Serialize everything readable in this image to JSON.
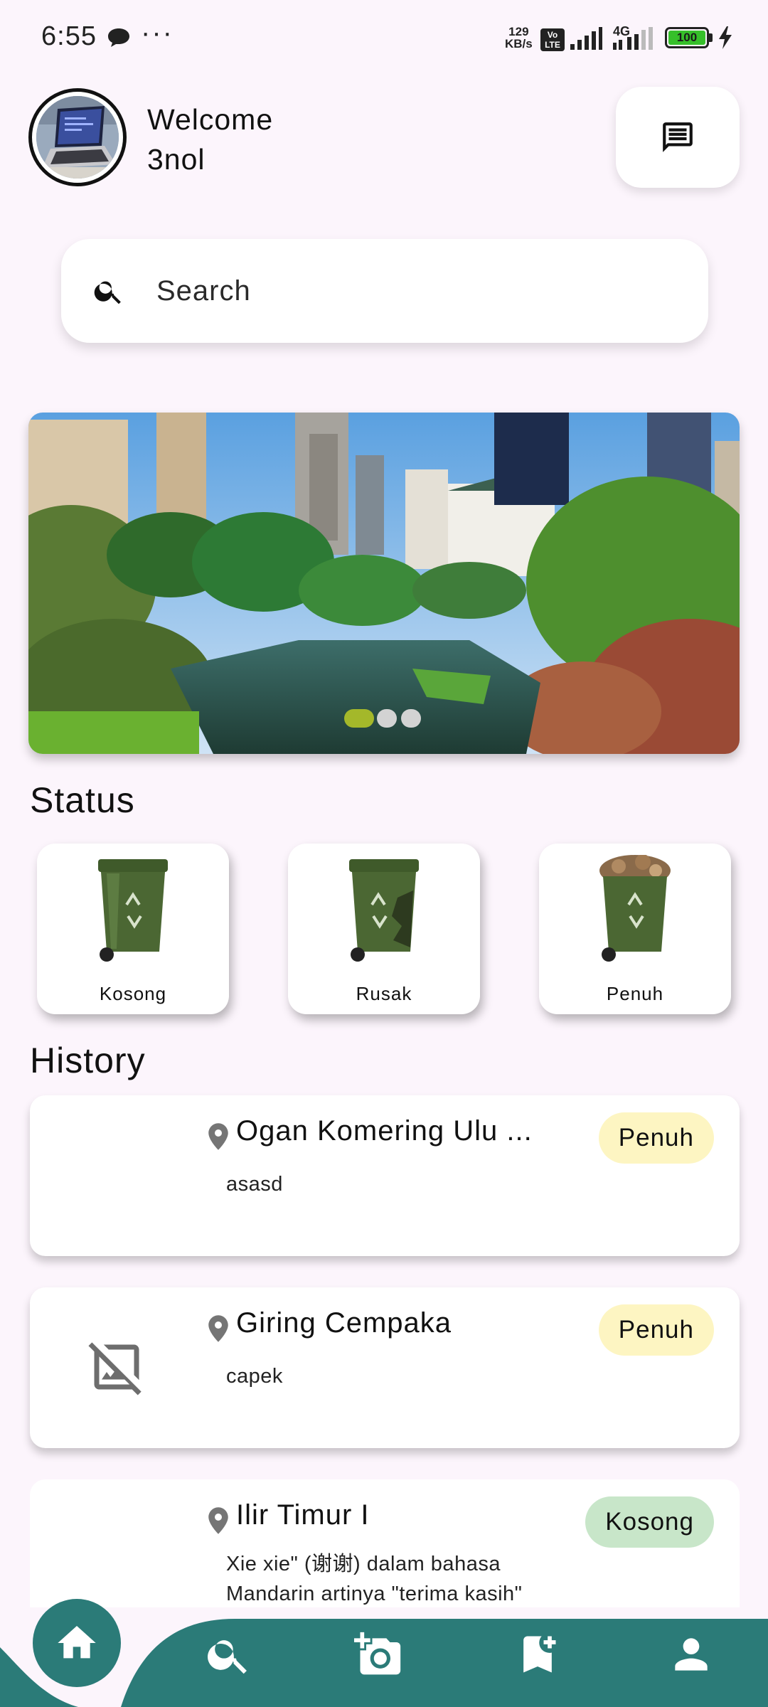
{
  "status_bar": {
    "time": "6:55",
    "net_speed_value": "129",
    "net_speed_unit": "KB/s",
    "volte": "Vo LTE",
    "network": "4G",
    "battery": "100"
  },
  "header": {
    "welcome": "Welcome",
    "username": "3nol",
    "message_icon": "message-icon"
  },
  "search": {
    "placeholder": "Search",
    "icon": "search-icon"
  },
  "carousel": {
    "active_index": 0,
    "count": 3,
    "active_color": "#a4b82a",
    "inactive_color": "#d3d3d3"
  },
  "status": {
    "title": "Status",
    "items": [
      {
        "label": "Kosong"
      },
      {
        "label": "Rusak"
      },
      {
        "label": "Penuh"
      }
    ]
  },
  "history": {
    "title": "History",
    "items": [
      {
        "title": "Ogan Komering Ulu ...",
        "desc": "asasd",
        "badge": "Penuh",
        "badge_color": "#fdf5c2"
      },
      {
        "title": "Giring Cempaka",
        "desc": "capek",
        "badge": "Penuh",
        "badge_color": "#fdf5c2"
      },
      {
        "title": "Ilir Timur I",
        "desc": "Xie xie\" (谢谢) dalam bahasa Mandarin artinya \"terima kasih\"",
        "badge": "Kosong",
        "badge_color": "#c8e6c9"
      }
    ]
  },
  "nav": {
    "color": "#2b7b78",
    "items": [
      "home-icon",
      "search-icon",
      "add-photo-icon",
      "bookmark-add-icon",
      "person-icon"
    ]
  }
}
